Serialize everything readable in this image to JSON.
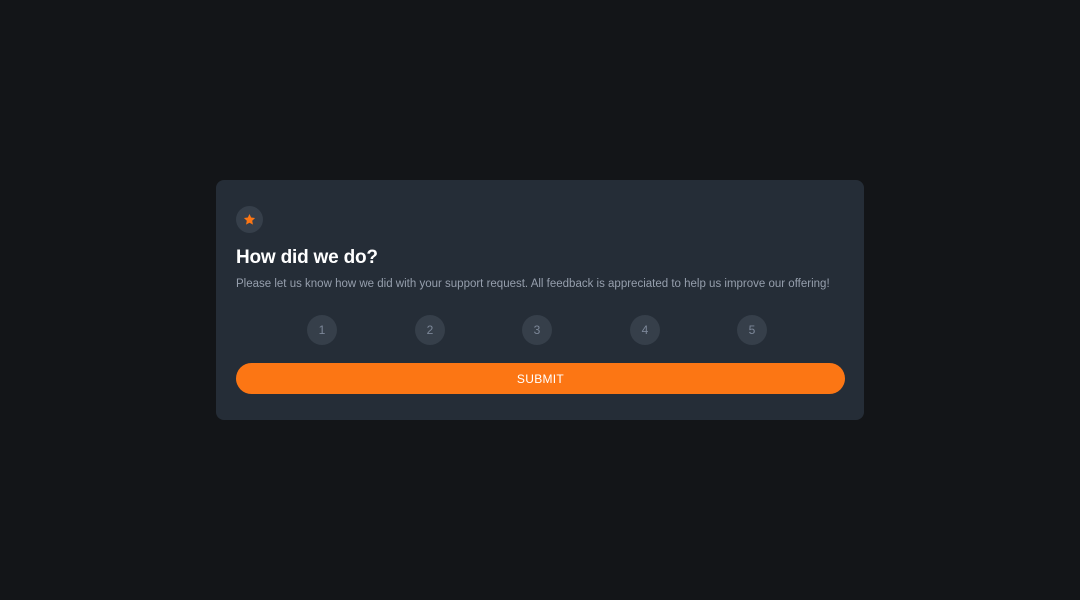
{
  "card": {
    "icon": "star-icon",
    "title": "How did we do?",
    "description": "Please let us know how we did with your support request. All feedback is appreciated to help us improve our offering!"
  },
  "ratings": [
    "1",
    "2",
    "3",
    "4",
    "5"
  ],
  "submit_label": "SUBMIT",
  "colors": {
    "page_background": "#131518",
    "card_background": "#252d37",
    "circle_background": "#363f4a",
    "accent": "#fc7614",
    "title_text": "#ffffff",
    "body_text": "#969fad"
  }
}
